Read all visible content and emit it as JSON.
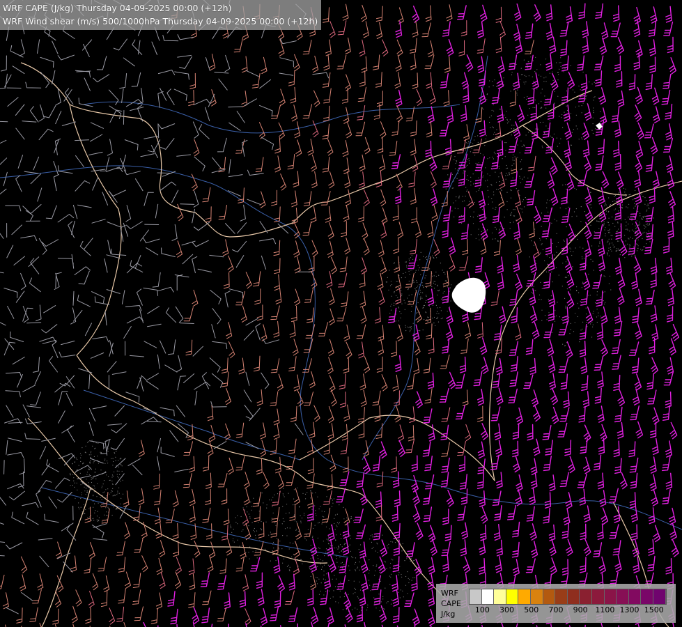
{
  "title": {
    "line1": "WRF CAPE (J/kg) Thursday 04-09-2025 00:00 (+12h)",
    "line2": "WRF Wind shear (m/s) 500/1000hPa Thursday 04-09-2025 00:00 (+12h)"
  },
  "legend": {
    "line1": "WRF",
    "line2": "CAPE",
    "line3": "J/kg",
    "ticks": [
      "100",
      "300",
      "500",
      "700",
      "900",
      "1100",
      "1300",
      "1500"
    ],
    "colors": [
      "#c8c8c8",
      "#ffffff",
      "#ffff99",
      "#ffff00",
      "#ffaa00",
      "#d9820f",
      "#b35a10",
      "#993d18",
      "#8f2e1e",
      "#8a2030",
      "#8c1a3c",
      "#8a1448",
      "#870f55",
      "#820a60",
      "#7a0668",
      "#70046e"
    ]
  },
  "colors": {
    "background": "#000000",
    "borders": "#e8c8a8",
    "rivers": "#3a5fa8",
    "barb_weak": "#a0a0a8",
    "barb_moderate": "#d88878",
    "barb_strong": "#e020e0",
    "cape_high": "#ffffff"
  }
}
